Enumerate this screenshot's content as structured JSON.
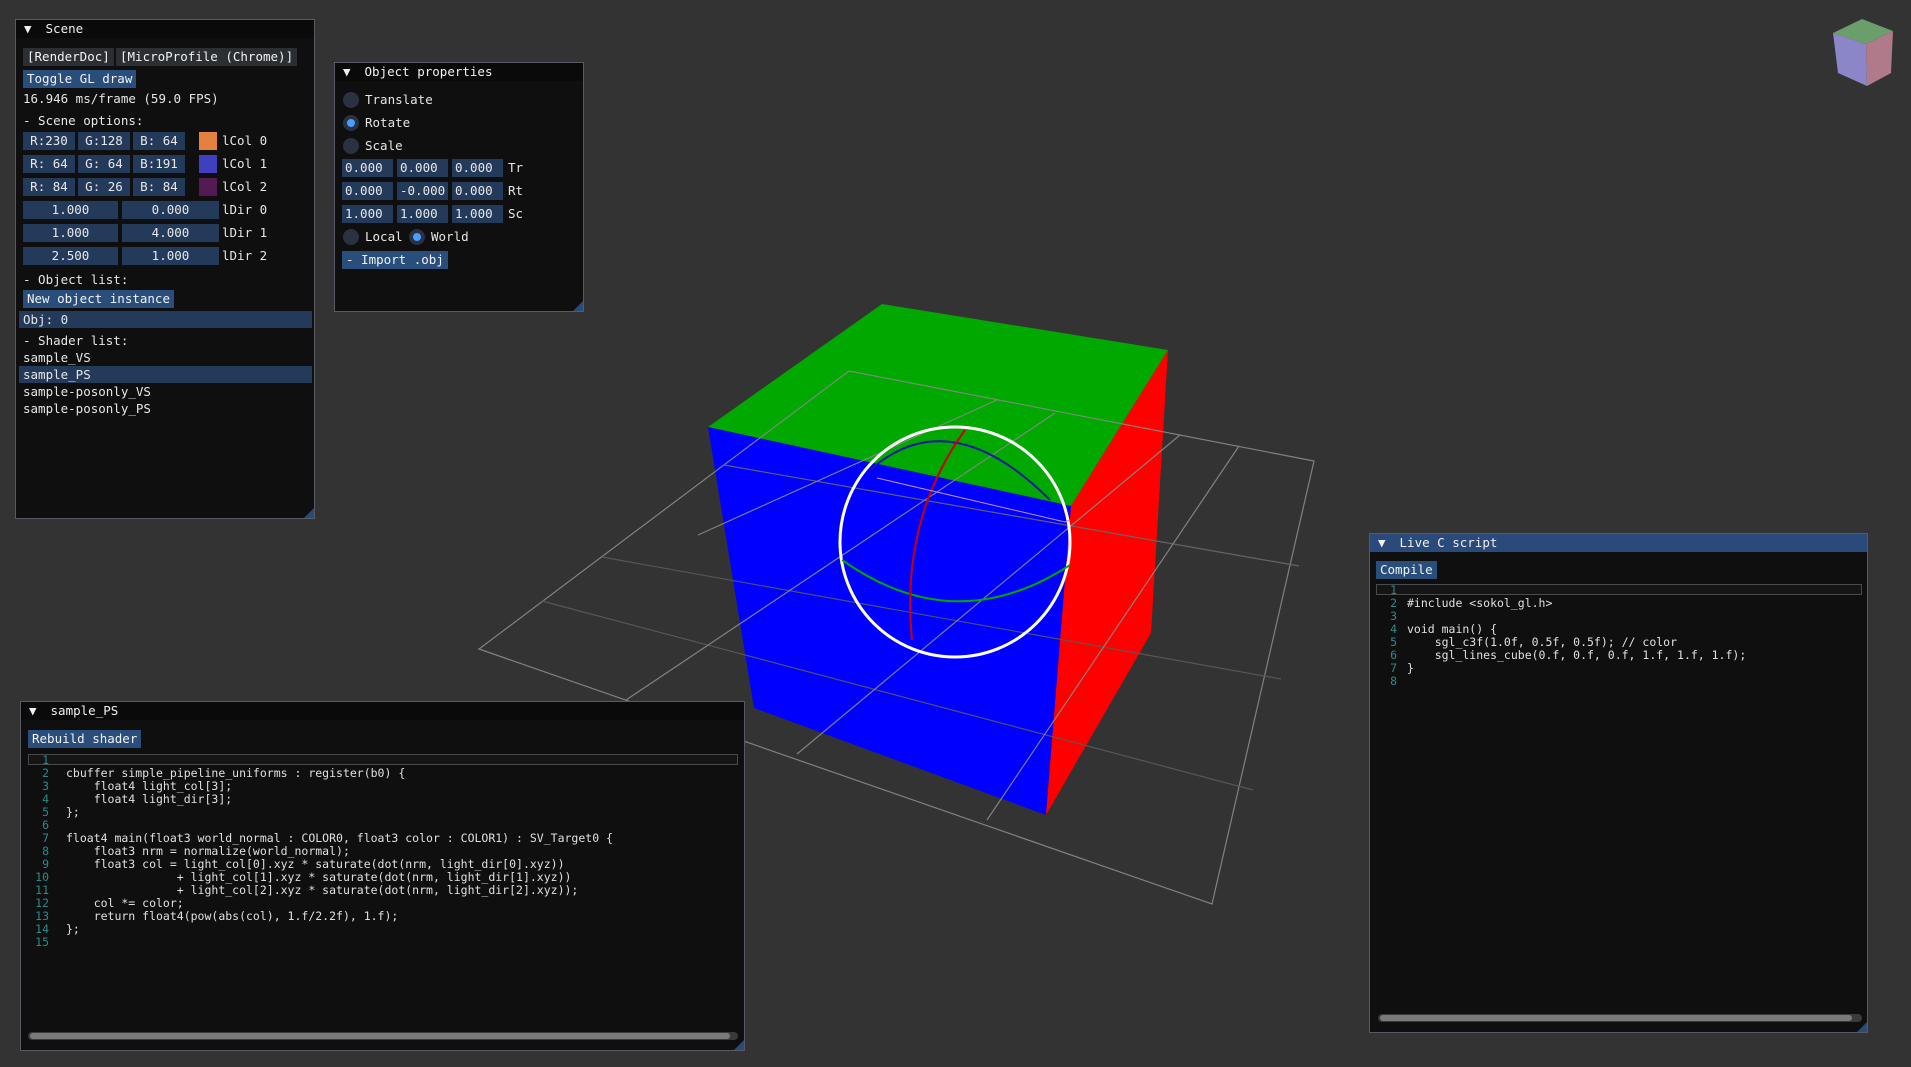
{
  "viewport": {
    "background": "#333333",
    "cube_faces": {
      "top": "#00a800",
      "front": "#0000ff",
      "right": "#ff0000"
    },
    "gizmo": "orientation-cube"
  },
  "scene": {
    "title": "Scene",
    "renderdoc_button": "[RenderDoc]",
    "microprofile_button": "[MicroProfile (Chrome)]",
    "toggle_gl_button": "Toggle GL draw",
    "frame_time": "16.946 ms/frame (59.0 FPS)",
    "scene_options_header": "- Scene options:",
    "light_colors": [
      {
        "r": "R:230",
        "g": "G:128",
        "b": "B: 64",
        "swatch": "#e6803f",
        "label": "lCol 0"
      },
      {
        "r": "R: 64",
        "g": "G: 64",
        "b": "B:191",
        "swatch": "#4040bf",
        "label": "lCol 1"
      },
      {
        "r": "R: 84",
        "g": "G: 26",
        "b": "B: 84",
        "swatch": "#541a54",
        "label": "lCol 2"
      }
    ],
    "light_dirs": [
      {
        "a": "1.000",
        "b": "0.000",
        "label": "lDir 0"
      },
      {
        "a": "1.000",
        "b": "4.000",
        "label": "lDir 1"
      },
      {
        "a": "2.500",
        "b": "1.000",
        "label": "lDir 2"
      }
    ],
    "object_list_header": "- Object list:",
    "new_object_button": "New object instance",
    "objects": [
      "Obj: 0"
    ],
    "shader_list_header": "- Shader list:",
    "shaders": [
      "sample_VS",
      "sample_PS",
      "sample-posonly_VS",
      "sample-posonly_PS"
    ],
    "selected_shader": "sample_PS"
  },
  "object_properties": {
    "title": "Object properties",
    "modes": [
      "Translate",
      "Rotate",
      "Scale"
    ],
    "selected_mode": "Rotate",
    "rows": [
      {
        "values": [
          "0.000",
          "0.000",
          "0.000"
        ],
        "label": "Tr"
      },
      {
        "values": [
          "0.000",
          "-0.000",
          "0.000"
        ],
        "label": "Rt"
      },
      {
        "values": [
          "1.000",
          "1.000",
          "1.000"
        ],
        "label": "Sc"
      }
    ],
    "space_local": "Local",
    "space_world": "World",
    "selected_space": "World",
    "import_button": "- Import .obj"
  },
  "shader_editor": {
    "title": "sample_PS",
    "rebuild_button": "Rebuild shader",
    "line_numbers": [
      "1",
      "2",
      "3",
      "4",
      "5",
      "6",
      "7",
      "8",
      "9",
      "10",
      "11",
      "12",
      "13",
      "14",
      "15"
    ],
    "lines": [
      "",
      "cbuffer simple_pipeline_uniforms : register(b0) {",
      "    float4 light_col[3];",
      "    float4 light_dir[3];",
      "};",
      "",
      "float4 main(float3 world_normal : COLOR0, float3 color : COLOR1) : SV_Target0 {",
      "    float3 nrm = normalize(world_normal);",
      "    float3 col = light_col[0].xyz * saturate(dot(nrm, light_dir[0].xyz))",
      "                + light_col[1].xyz * saturate(dot(nrm, light_dir[1].xyz))",
      "                + light_col[2].xyz * saturate(dot(nrm, light_dir[2].xyz));",
      "    col *= color;",
      "    return float4(pow(abs(col), 1.f/2.2f), 1.f);",
      "};",
      ""
    ]
  },
  "live_script": {
    "title": "Live C script",
    "compile_button": "Compile",
    "line_numbers": [
      "1",
      "2",
      "3",
      "4",
      "5",
      "6",
      "7",
      "8"
    ],
    "lines": [
      "",
      "#include <sokol_gl.h>",
      "",
      "void main() {",
      "    sgl_c3f(1.0f, 0.5f, 0.5f); // color",
      "    sgl_lines_cube(0.f, 0.f, 0.f, 1.f, 1.f, 1.f);",
      "}",
      ""
    ]
  }
}
